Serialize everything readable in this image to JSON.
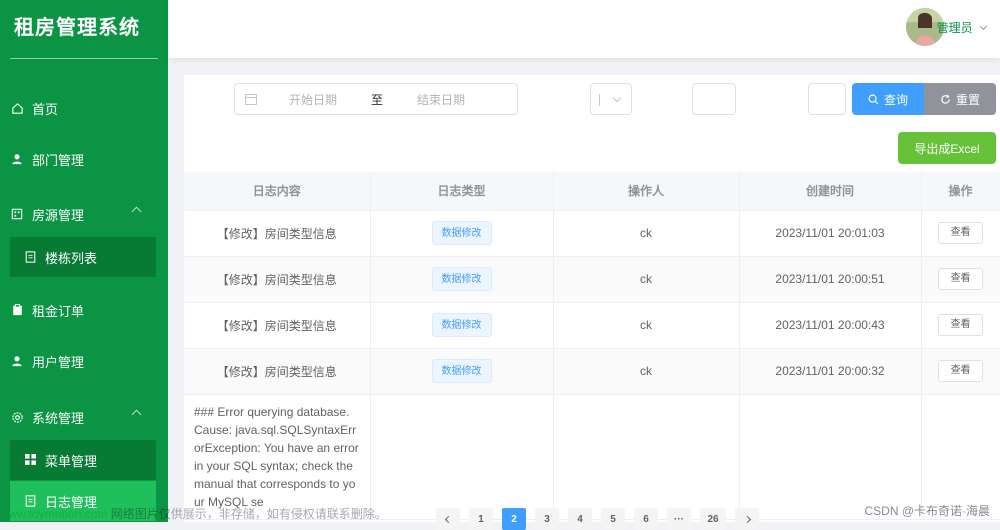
{
  "app": {
    "title": "租房管理系统"
  },
  "sidebar": {
    "items": [
      {
        "label": "首页",
        "icon": "home-icon"
      },
      {
        "label": "部门管理",
        "icon": "user-icon"
      },
      {
        "label": "房源管理",
        "icon": "building-icon",
        "expanded": true
      },
      {
        "label": "楼栋列表",
        "icon": "document-icon"
      },
      {
        "label": "租金订单",
        "icon": "clipboard-icon"
      },
      {
        "label": "用户管理",
        "icon": "user-icon"
      },
      {
        "label": "系统管理",
        "icon": "gear-icon",
        "expanded": true
      },
      {
        "label": "菜单管理",
        "icon": "grid-icon"
      },
      {
        "label": "日志管理",
        "icon": "document-icon",
        "active": true
      }
    ]
  },
  "header": {
    "user_name": "管理员"
  },
  "filters": {
    "start_placeholder": "开始日期",
    "separator": "至",
    "end_placeholder": "结束日期",
    "select_value": "",
    "input1_value": "",
    "input2_value": "",
    "query_label": "查询",
    "reset_label": "重置",
    "export_label": "导出成Excel"
  },
  "table": {
    "columns": [
      "日志内容",
      "日志类型",
      "操作人",
      "创建时间",
      "操作"
    ],
    "rows": [
      {
        "content": "【修改】房间类型信息",
        "type": "数据修改",
        "operator": "ck",
        "time": "2023/11/01 20:01:03",
        "action": "查看"
      },
      {
        "content": "【修改】房间类型信息",
        "type": "数据修改",
        "operator": "ck",
        "time": "2023/11/01 20:00:51",
        "action": "查看"
      },
      {
        "content": "【修改】房间类型信息",
        "type": "数据修改",
        "operator": "ck",
        "time": "2023/11/01 20:00:43",
        "action": "查看"
      },
      {
        "content": "【修改】房间类型信息",
        "type": "数据修改",
        "operator": "ck",
        "time": "2023/11/01 20:00:32",
        "action": "查看"
      }
    ],
    "error_row": "### Error querying database. Cause: java.sql.SQLSyntaxErrorException: You have an error in your SQL syntax; check the manual that corresponds to your MySQL se"
  },
  "pagination": {
    "pages": [
      "1",
      "2",
      "3",
      "4",
      "5",
      "6",
      "···",
      "26"
    ],
    "current": "2"
  },
  "watermark": {
    "site": "www.toymoban.com",
    "notice": "网络图片仅供展示，非存储，如有侵权请联系删除。"
  },
  "csdn_credit": "CSDN @卡布奇诺·海晨",
  "colors": {
    "sidebar": "#0b9444",
    "primary": "#409eff",
    "success": "#67c23a",
    "info": "#909399"
  }
}
